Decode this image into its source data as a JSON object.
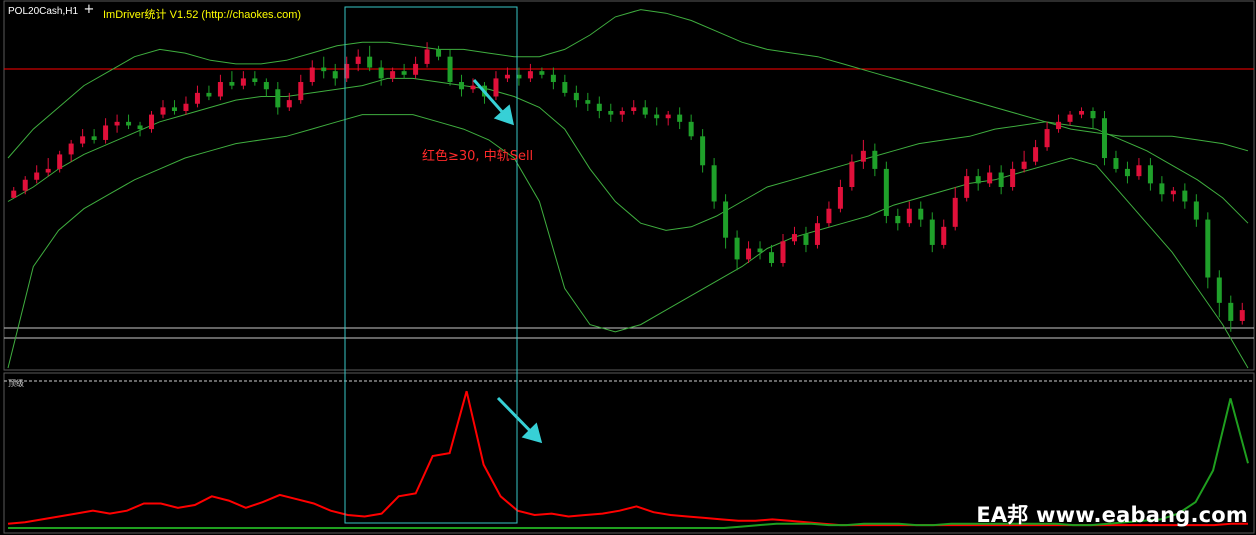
{
  "header": {
    "symbol": "POL20Cash,H1",
    "indicator": "ImDriver统计 V1.52  (http://chaokes.com)",
    "add_icon": "+"
  },
  "annotation": {
    "text": "红色≥30, 中轨Sell"
  },
  "subwindow": {
    "label": "顶级"
  },
  "watermark": {
    "text": "EA邦 www.eabang.com"
  },
  "colors": {
    "background": "#000000",
    "bull_candle": "#e0103a",
    "bear_candle": "#1fa02a",
    "bollinger": "#3fae3f",
    "horizontal_red": "#ff0000",
    "horizontal_white": "#c8c8c8",
    "highlight_box": "#39c6c6",
    "arrow": "#37d0d6",
    "indicator_red": "#ff0000",
    "indicator_green": "#1f9f1f"
  },
  "chart_data": [
    {
      "type": "candlestick",
      "title": "POL20Cash,H1",
      "comment": "price pane; values in relative price units (0 = bottom of pane, 100 = top)",
      "ylim": [
        0,
        100
      ],
      "grid": false,
      "candles": [
        [
          47,
          49,
          50,
          47
        ],
        [
          49,
          52,
          53,
          48
        ],
        [
          52,
          54,
          56,
          51
        ],
        [
          54,
          55,
          58,
          53
        ],
        [
          55,
          59,
          60,
          54
        ],
        [
          59,
          62,
          63,
          57
        ],
        [
          62,
          64,
          66,
          61
        ],
        [
          64,
          63,
          66,
          62
        ],
        [
          63,
          67,
          69,
          62
        ],
        [
          67,
          68,
          70,
          65
        ],
        [
          68,
          67,
          70,
          66
        ],
        [
          67,
          66,
          68,
          64
        ],
        [
          66,
          70,
          71,
          65
        ],
        [
          70,
          72,
          74,
          69
        ],
        [
          72,
          71,
          74,
          70
        ],
        [
          71,
          73,
          75,
          70
        ],
        [
          73,
          76,
          78,
          72
        ],
        [
          76,
          75,
          78,
          74
        ],
        [
          75,
          79,
          81,
          74
        ],
        [
          79,
          78,
          82,
          77
        ],
        [
          78,
          80,
          82,
          77
        ],
        [
          80,
          79,
          82,
          78
        ],
        [
          79,
          77,
          80,
          75
        ],
        [
          77,
          72,
          79,
          70
        ],
        [
          72,
          74,
          76,
          71
        ],
        [
          74,
          79,
          81,
          73
        ],
        [
          79,
          83,
          85,
          78
        ],
        [
          83,
          82,
          86,
          80
        ],
        [
          82,
          80,
          84,
          78
        ],
        [
          80,
          84,
          86,
          79
        ],
        [
          84,
          86,
          88,
          82
        ],
        [
          86,
          83,
          89,
          82
        ],
        [
          83,
          80,
          85,
          78
        ],
        [
          80,
          82,
          83,
          79
        ],
        [
          82,
          81,
          84,
          80
        ],
        [
          81,
          84,
          86,
          80
        ],
        [
          84,
          88,
          90,
          83
        ],
        [
          88,
          86,
          89,
          85
        ],
        [
          86,
          79,
          88,
          78
        ],
        [
          79,
          77,
          81,
          75
        ],
        [
          77,
          78,
          80,
          76
        ],
        [
          78,
          75,
          79,
          73
        ],
        [
          75,
          80,
          82,
          74
        ],
        [
          80,
          81,
          83,
          79
        ],
        [
          81,
          80,
          83,
          78
        ],
        [
          80,
          82,
          84,
          79
        ],
        [
          82,
          81,
          83,
          80
        ],
        [
          81,
          79,
          83,
          77
        ],
        [
          79,
          76,
          81,
          75
        ],
        [
          76,
          74,
          78,
          72
        ],
        [
          74,
          73,
          76,
          71
        ],
        [
          73,
          71,
          75,
          69
        ],
        [
          71,
          70,
          73,
          68
        ],
        [
          70,
          71,
          72,
          68
        ],
        [
          71,
          72,
          74,
          70
        ],
        [
          72,
          70,
          74,
          69
        ],
        [
          70,
          69,
          72,
          67
        ],
        [
          69,
          70,
          71,
          67
        ],
        [
          70,
          68,
          72,
          66
        ],
        [
          68,
          64,
          70,
          63
        ],
        [
          64,
          56,
          66,
          54
        ],
        [
          56,
          46,
          58,
          44
        ],
        [
          46,
          36,
          48,
          33
        ],
        [
          36,
          30,
          38,
          27
        ],
        [
          30,
          33,
          35,
          29
        ],
        [
          33,
          32,
          35,
          30
        ],
        [
          32,
          29,
          34,
          28
        ],
        [
          29,
          35,
          37,
          28
        ],
        [
          35,
          37,
          39,
          34
        ],
        [
          37,
          34,
          39,
          32
        ],
        [
          34,
          40,
          42,
          33
        ],
        [
          40,
          44,
          46,
          39
        ],
        [
          44,
          50,
          52,
          43
        ],
        [
          50,
          57,
          59,
          49
        ],
        [
          57,
          60,
          63,
          55
        ],
        [
          60,
          55,
          62,
          53
        ],
        [
          55,
          42,
          57,
          40
        ],
        [
          42,
          40,
          44,
          38
        ],
        [
          40,
          44,
          46,
          39
        ],
        [
          44,
          41,
          46,
          39
        ],
        [
          41,
          34,
          43,
          32
        ],
        [
          34,
          39,
          41,
          33
        ],
        [
          39,
          47,
          50,
          38
        ],
        [
          47,
          53,
          55,
          46
        ],
        [
          53,
          51,
          55,
          49
        ],
        [
          51,
          54,
          56,
          50
        ],
        [
          54,
          50,
          56,
          48
        ],
        [
          50,
          55,
          57,
          49
        ],
        [
          55,
          57,
          60,
          54
        ],
        [
          57,
          61,
          63,
          56
        ],
        [
          61,
          66,
          68,
          60
        ],
        [
          66,
          68,
          70,
          65
        ],
        [
          68,
          70,
          71,
          67
        ],
        [
          70,
          71,
          72,
          69
        ],
        [
          71,
          69,
          72,
          66
        ],
        [
          69,
          58,
          71,
          56
        ],
        [
          58,
          55,
          60,
          54
        ],
        [
          55,
          53,
          57,
          51
        ],
        [
          53,
          56,
          58,
          52
        ],
        [
          56,
          51,
          58,
          49
        ],
        [
          51,
          48,
          53,
          46
        ],
        [
          48,
          49,
          50,
          46
        ],
        [
          49,
          46,
          51,
          44
        ],
        [
          46,
          41,
          48,
          39
        ],
        [
          41,
          25,
          43,
          22
        ],
        [
          25,
          18,
          27,
          14
        ],
        [
          18,
          13,
          20,
          10
        ],
        [
          13,
          16,
          18,
          12
        ]
      ],
      "bollinger": {
        "upper": [
          58,
          66,
          72,
          78,
          82,
          86,
          88,
          87,
          85,
          84,
          84,
          85,
          87,
          89,
          90,
          90,
          89,
          88,
          88,
          87,
          86,
          86,
          88,
          92,
          97,
          99,
          98,
          96,
          93,
          90,
          88,
          87,
          86,
          84,
          82,
          80,
          78,
          76,
          74,
          72,
          70,
          68,
          66,
          65,
          64,
          64,
          64,
          63,
          62,
          60
        ],
        "middle": [
          46,
          50,
          55,
          59,
          62,
          65,
          68,
          70,
          72,
          74,
          75,
          75,
          76,
          77,
          78,
          80,
          80,
          79,
          78,
          77,
          75,
          72,
          66,
          55,
          46,
          40,
          38,
          39,
          42,
          46,
          50,
          52,
          54,
          56,
          58,
          60,
          62,
          63,
          64,
          66,
          67,
          68,
          67,
          66,
          63,
          60,
          56,
          52,
          47,
          40
        ],
        "lower": [
          0,
          28,
          38,
          44,
          48,
          52,
          55,
          58,
          60,
          62,
          63,
          64,
          66,
          68,
          70,
          70,
          70,
          68,
          66,
          63,
          58,
          46,
          22,
          12,
          10,
          12,
          16,
          20,
          24,
          28,
          33,
          36,
          38,
          40,
          42,
          45,
          47,
          49,
          51,
          52,
          54,
          56,
          58,
          56,
          48,
          40,
          32,
          22,
          12,
          0
        ]
      }
    },
    {
      "type": "line",
      "title": "",
      "comment": "indicator sub-window; relative values (0 = bottom, 100 = top)",
      "ylim": [
        0,
        100
      ],
      "series": [
        {
          "color": "red",
          "values": [
            3,
            4,
            6,
            8,
            10,
            12,
            10,
            12,
            17,
            17,
            14,
            16,
            22,
            19,
            14,
            18,
            23,
            20,
            17,
            12,
            9,
            8,
            10,
            22,
            24,
            50,
            52,
            95,
            44,
            22,
            12,
            9,
            10,
            8,
            9,
            10,
            12,
            15,
            11,
            9,
            8,
            7,
            6,
            5,
            5,
            6,
            5,
            4,
            3,
            2,
            2,
            2,
            2,
            2,
            2,
            2,
            2,
            2,
            2,
            2,
            2,
            2,
            2,
            2,
            2,
            2,
            2,
            2,
            2,
            2,
            2,
            2,
            3,
            3
          ]
        },
        {
          "color": "green",
          "values": [
            0,
            0,
            0,
            0,
            0,
            0,
            0,
            0,
            0,
            0,
            0,
            0,
            0,
            0,
            0,
            0,
            0,
            0,
            0,
            0,
            0,
            0,
            0,
            0,
            0,
            0,
            0,
            0,
            0,
            0,
            0,
            0,
            0,
            0,
            0,
            0,
            0,
            0,
            0,
            0,
            0,
            0,
            1,
            2,
            3,
            3,
            3,
            2,
            2,
            3,
            3,
            3,
            2,
            2,
            3,
            3,
            3,
            3,
            3,
            3,
            3,
            2,
            2,
            3,
            4,
            5,
            6,
            10,
            18,
            40,
            90,
            45
          ]
        }
      ]
    }
  ]
}
